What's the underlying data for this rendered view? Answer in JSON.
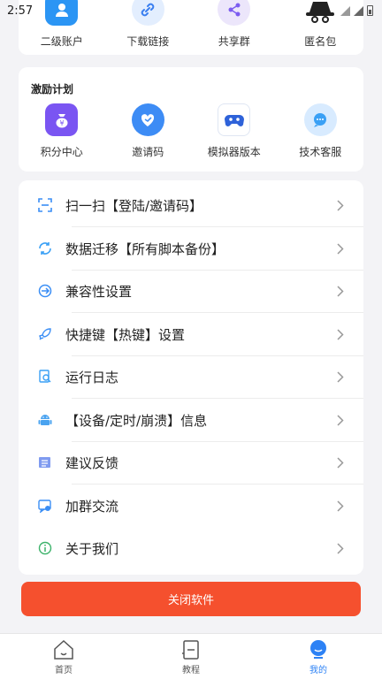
{
  "status_bar": {
    "time": "2:57"
  },
  "top_grid": [
    {
      "label": "二级账户",
      "icon": "sub-account-icon"
    },
    {
      "label": "下载链接",
      "icon": "link-icon"
    },
    {
      "label": "共享群",
      "icon": "share-group-icon"
    },
    {
      "label": "匿名包",
      "icon": "anonymous-icon"
    }
  ],
  "incentive": {
    "title": "激励计划",
    "items": [
      {
        "label": "积分中心",
        "icon": "points-bag-icon"
      },
      {
        "label": "邀请码",
        "icon": "invite-heart-icon"
      },
      {
        "label": "模拟器版本",
        "icon": "gamepad-icon"
      },
      {
        "label": "技术客服",
        "icon": "support-chat-icon"
      }
    ]
  },
  "menu": [
    {
      "label": "扫一扫【登陆/邀请码】",
      "icon": "scan-icon"
    },
    {
      "label": "数据迁移【所有脚本备份】",
      "icon": "sync-icon"
    },
    {
      "label": "兼容性设置",
      "icon": "compat-icon"
    },
    {
      "label": "快捷键【热键】设置",
      "icon": "rocket-icon"
    },
    {
      "label": "运行日志",
      "icon": "log-search-icon"
    },
    {
      "label": "【设备/定时/崩溃】信息",
      "icon": "android-icon"
    },
    {
      "label": "建议反馈",
      "icon": "feedback-icon"
    },
    {
      "label": "加群交流",
      "icon": "group-chat-icon"
    },
    {
      "label": "关于我们",
      "icon": "info-icon"
    }
  ],
  "close_button": "关闭软件",
  "bottom_nav": [
    {
      "label": "首页",
      "icon": "home-icon",
      "active": false
    },
    {
      "label": "教程",
      "icon": "tutorial-icon",
      "active": false
    },
    {
      "label": "我的",
      "icon": "profile-icon",
      "active": true
    }
  ],
  "colors": {
    "accent": "#2d82f5",
    "danger": "#f5502e",
    "background": "#f3f3f6"
  }
}
